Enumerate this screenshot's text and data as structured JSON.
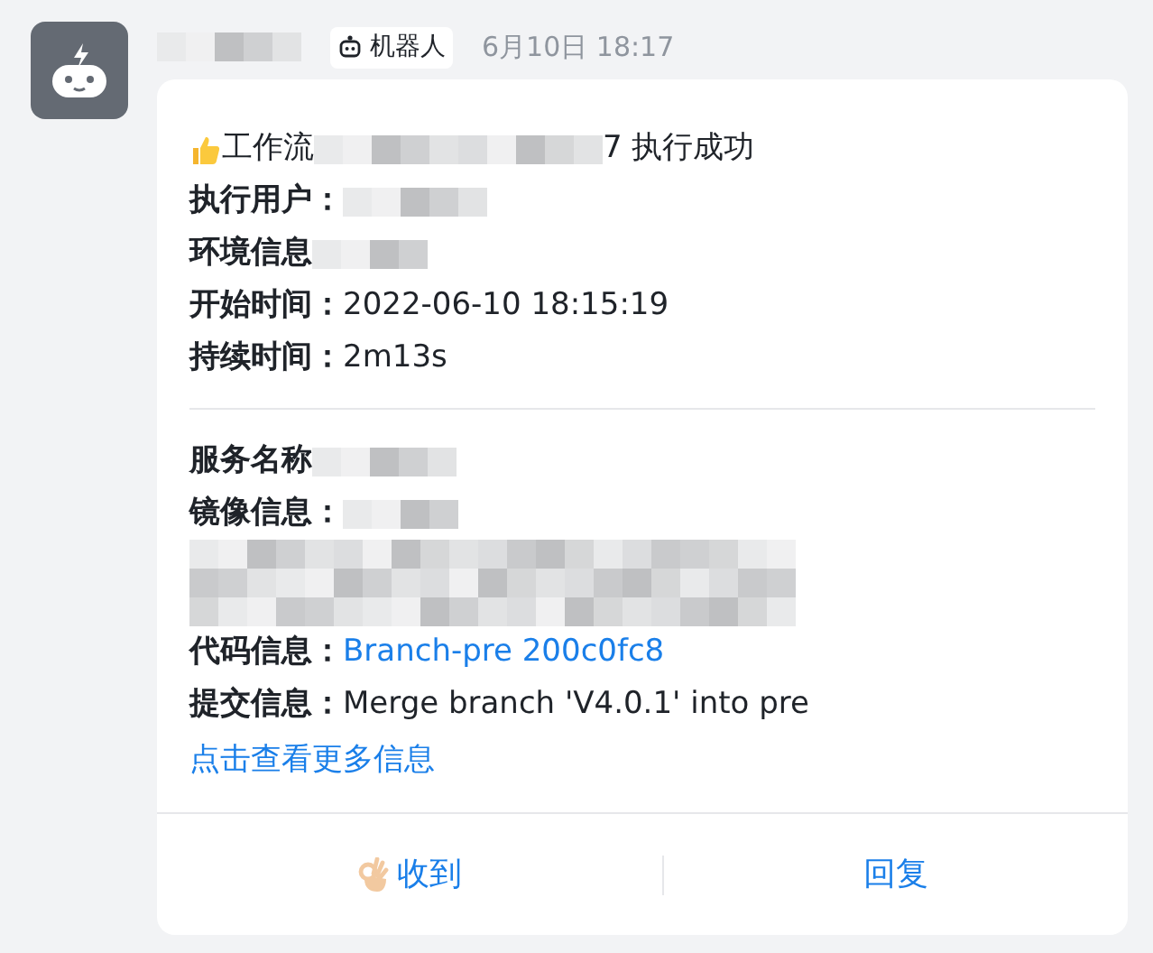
{
  "header": {
    "sender": {
      "kind": "redacted"
    },
    "tag": "机器人",
    "time": "6月10日 18:17"
  },
  "card": {
    "title": {
      "kind": "success",
      "prefix": "工作流",
      "suffix": "7 执行成功"
    },
    "sections": [
      [
        {
          "label": "执行用户：",
          "kind": "redacted"
        },
        {
          "label": "环境信息",
          "kind": "redacted"
        },
        {
          "label": "开始时间：",
          "kind": "text",
          "value": "2022-06-10 18:15:19"
        },
        {
          "label": "持续时间：",
          "kind": "text",
          "value": "2m13s"
        }
      ],
      [
        {
          "label": "服务名称",
          "kind": "redacted"
        },
        {
          "label": "镜像信息：",
          "kind": "redacted"
        },
        {
          "kind": "redacted-block"
        },
        {
          "label": "代码信息：",
          "kind": "link",
          "value": "Branch-pre 200c0fc8"
        },
        {
          "label": "提交信息：",
          "kind": "text",
          "value": "Merge branch 'V4.0.1' into pre"
        }
      ]
    ],
    "more_link": "点击查看更多信息",
    "actions": [
      {
        "label": "收到",
        "kind": "acknowledge"
      },
      {
        "label": "回复",
        "kind": "reply"
      }
    ]
  }
}
